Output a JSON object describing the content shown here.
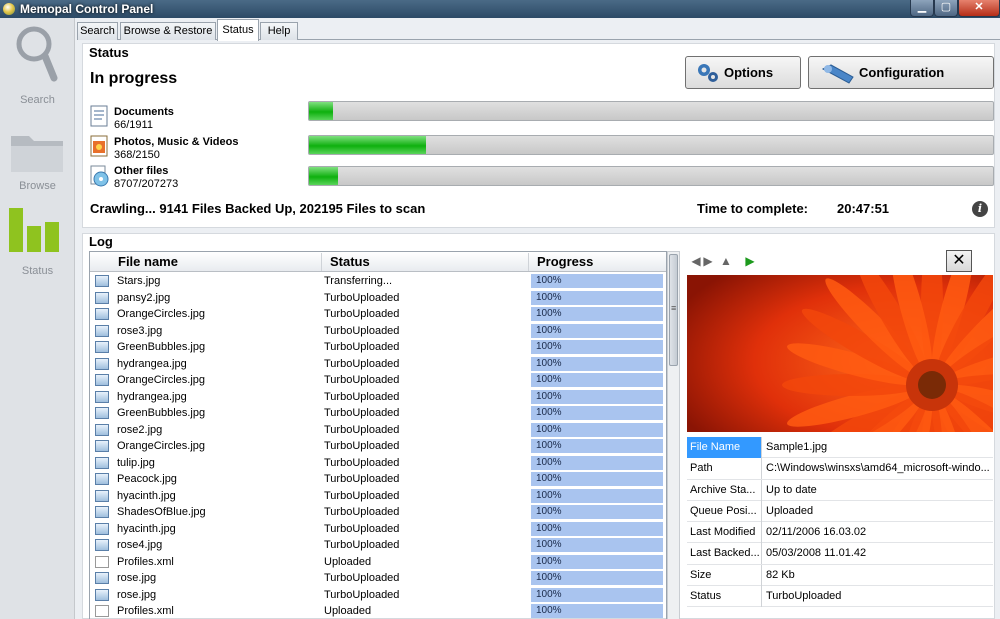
{
  "window": {
    "title": "Memopal Control Panel"
  },
  "sidebar": {
    "items": [
      {
        "label": "Search",
        "icon": "search-icon"
      },
      {
        "label": "Browse",
        "icon": "folder-icon"
      },
      {
        "label": "Status",
        "icon": "status-bars-icon"
      }
    ]
  },
  "tabs": [
    "Search",
    "Browse & Restore",
    "Status",
    "Help"
  ],
  "active_tab": "Status",
  "status": {
    "section_title": "Status",
    "state": "In progress",
    "options_label": "Options",
    "configuration_label": "Configuration",
    "categories": [
      {
        "name": "Documents",
        "count": "66/1911",
        "progress": 0.035
      },
      {
        "name": "Photos, Music & Videos",
        "count": "368/2150",
        "progress": 0.171
      },
      {
        "name": "Other files",
        "count": "8707/207273",
        "progress": 0.042
      }
    ],
    "crawl_text": "Crawling... 9141 Files Backed Up, 202195 Files to scan",
    "time_label": "Time to complete:",
    "time_value": "20:47:51"
  },
  "log": {
    "section_title": "Log",
    "columns": [
      "File name",
      "Status",
      "Progress"
    ],
    "rows": [
      {
        "file": "Stars.jpg",
        "status": "Transferring...",
        "progress": "100%"
      },
      {
        "file": "pansy2.jpg",
        "status": "TurboUploaded",
        "progress": "100%"
      },
      {
        "file": "OrangeCircles.jpg",
        "status": "TurboUploaded",
        "progress": "100%"
      },
      {
        "file": "rose3.jpg",
        "status": "TurboUploaded",
        "progress": "100%"
      },
      {
        "file": "GreenBubbles.jpg",
        "status": "TurboUploaded",
        "progress": "100%"
      },
      {
        "file": "hydrangea.jpg",
        "status": "TurboUploaded",
        "progress": "100%"
      },
      {
        "file": "OrangeCircles.jpg",
        "status": "TurboUploaded",
        "progress": "100%"
      },
      {
        "file": "hydrangea.jpg",
        "status": "TurboUploaded",
        "progress": "100%"
      },
      {
        "file": "GreenBubbles.jpg",
        "status": "TurboUploaded",
        "progress": "100%"
      },
      {
        "file": "rose2.jpg",
        "status": "TurboUploaded",
        "progress": "100%"
      },
      {
        "file": "OrangeCircles.jpg",
        "status": "TurboUploaded",
        "progress": "100%"
      },
      {
        "file": "tulip.jpg",
        "status": "TurboUploaded",
        "progress": "100%"
      },
      {
        "file": "Peacock.jpg",
        "status": "TurboUploaded",
        "progress": "100%"
      },
      {
        "file": "hyacinth.jpg",
        "status": "TurboUploaded",
        "progress": "100%"
      },
      {
        "file": "ShadesOfBlue.jpg",
        "status": "TurboUploaded",
        "progress": "100%"
      },
      {
        "file": "hyacinth.jpg",
        "status": "TurboUploaded",
        "progress": "100%"
      },
      {
        "file": "rose4.jpg",
        "status": "TurboUploaded",
        "progress": "100%"
      },
      {
        "file": "Profiles.xml",
        "status": "Uploaded",
        "progress": "100%"
      },
      {
        "file": "rose.jpg",
        "status": "TurboUploaded",
        "progress": "100%"
      },
      {
        "file": "rose.jpg",
        "status": "TurboUploaded",
        "progress": "100%"
      },
      {
        "file": "Profiles.xml",
        "status": "Uploaded",
        "progress": "100%"
      }
    ]
  },
  "preview": {
    "properties": [
      {
        "key": "File Name",
        "value": "Sample1.jpg"
      },
      {
        "key": "Path",
        "value": "C:\\Windows\\winsxs\\amd64_microsoft-windo..."
      },
      {
        "key": "Archive Sta...",
        "value": "Up to date"
      },
      {
        "key": "Queue Posi...",
        "value": "Uploaded"
      },
      {
        "key": "Last Modified",
        "value": "02/11/2006 16.03.02"
      },
      {
        "key": "Last Backed...",
        "value": "05/03/2008 11.01.42"
      },
      {
        "key": "Size",
        "value": "82 Kb"
      },
      {
        "key": "Status",
        "value": "TurboUploaded"
      }
    ]
  },
  "colors": {
    "progress_green": "#0eb00e",
    "log_progress_blue": "#a9c4ef",
    "selection_blue": "#3399ff"
  }
}
